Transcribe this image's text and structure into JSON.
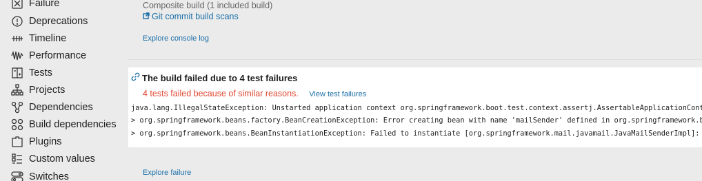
{
  "sidebar": {
    "items": [
      {
        "label": "Failure",
        "icon": "failure-icon"
      },
      {
        "label": "Deprecations",
        "icon": "deprecations-icon"
      },
      {
        "label": "Timeline",
        "icon": "timeline-icon"
      },
      {
        "label": "Performance",
        "icon": "performance-icon"
      },
      {
        "label": "Tests",
        "icon": "tests-icon"
      },
      {
        "label": "Projects",
        "icon": "projects-icon"
      },
      {
        "label": "Dependencies",
        "icon": "dependencies-icon"
      },
      {
        "label": "Build dependencies",
        "icon": "build-dependencies-icon"
      },
      {
        "label": "Plugins",
        "icon": "plugins-icon"
      },
      {
        "label": "Custom values",
        "icon": "custom-values-icon"
      },
      {
        "label": "Switches",
        "icon": "switches-icon"
      }
    ]
  },
  "main": {
    "composite_text": "Composite build (1 included build)",
    "git_scans_label": "Git commit build scans",
    "explore_console_label": "Explore console log",
    "failure_card": {
      "title": "The build failed due to 4 test failures",
      "summary": "4 tests failed because of similar reasons.",
      "view_link": "View test failures",
      "trace_lines": [
        "java.lang.IllegalStateException: Unstarted application context org.springframework.boot.test.context.assertj.AssertableApplicationContex",
        "> org.springframework.beans.factory.BeanCreationException: Error creating bean with name 'mailSender' defined in org.springframework.boo",
        "  > org.springframework.beans.BeanInstantiationException: Failed to instantiate [org.springframework.mail.javamail.JavaMailSenderImpl]:"
      ]
    },
    "explore_failure_label": "Explore failure"
  },
  "colors": {
    "link": "#1a6fa8",
    "error": "#e0462f",
    "background": "#ebebeb",
    "card": "#ffffff"
  }
}
